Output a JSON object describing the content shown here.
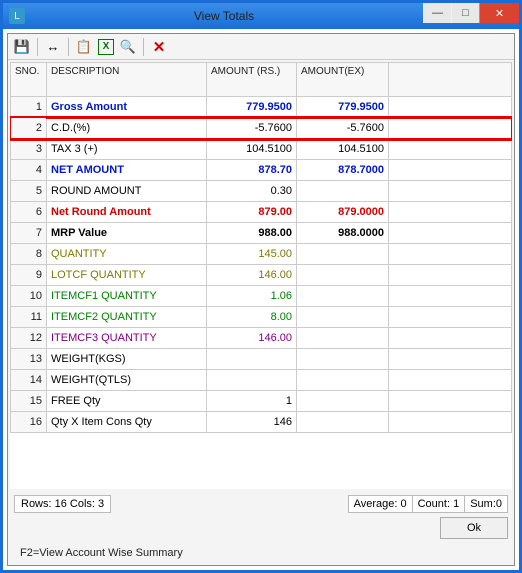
{
  "window": {
    "title": "View Totals",
    "app_icon_label": "L"
  },
  "toolbar_icons": {
    "save": "💾",
    "fit": "↔",
    "copy": "📋",
    "excel": "X",
    "find": "🔍",
    "delete": "✕"
  },
  "columns": {
    "sno": "SNO.",
    "description": "DESCRIPTION",
    "amount_rs": "AMOUNT (RS.)",
    "amount_ex": "AMOUNT(EX)"
  },
  "rows": [
    {
      "sno": "1",
      "desc": "Gross Amount",
      "amt1": "779.9500",
      "amt2": "779.9500",
      "cls": "c-blue bold",
      "highlight": false
    },
    {
      "sno": "2",
      "desc": "C.D.(%)",
      "amt1": "-5.7600",
      "amt2": "-5.7600",
      "cls": "c-black",
      "highlight": true
    },
    {
      "sno": "3",
      "desc": "TAX 3 (+)",
      "amt1": "104.5100",
      "amt2": "104.5100",
      "cls": "c-black",
      "highlight": false
    },
    {
      "sno": "4",
      "desc": "NET AMOUNT",
      "amt1": "878.70",
      "amt2": "878.7000",
      "cls": "c-blue bold",
      "highlight": false
    },
    {
      "sno": "5",
      "desc": "ROUND AMOUNT",
      "amt1": "0.30",
      "amt2": "",
      "cls": "c-black",
      "highlight": false
    },
    {
      "sno": "6",
      "desc": "Net Round Amount",
      "amt1": "879.00",
      "amt2": "879.0000",
      "cls": "c-red bold",
      "highlight": false
    },
    {
      "sno": "7",
      "desc": "MRP Value",
      "amt1": "988.00",
      "amt2": "988.0000",
      "cls": "c-black bold",
      "highlight": false
    },
    {
      "sno": "8",
      "desc": "QUANTITY",
      "amt1": "145.00",
      "amt2": "",
      "cls": "c-olive",
      "highlight": false
    },
    {
      "sno": "9",
      "desc": "LOTCF    QUANTITY",
      "amt1": "146.00",
      "amt2": "",
      "cls": "c-olive",
      "highlight": false
    },
    {
      "sno": "10",
      "desc": "ITEMCF1   QUANTITY",
      "amt1": "1.06",
      "amt2": "",
      "cls": "c-green",
      "highlight": false
    },
    {
      "sno": "11",
      "desc": "ITEMCF2   QUANTITY",
      "amt1": "8.00",
      "amt2": "",
      "cls": "c-green",
      "highlight": false
    },
    {
      "sno": "12",
      "desc": "ITEMCF3   QUANTITY",
      "amt1": "146.00",
      "amt2": "",
      "cls": "c-purple",
      "highlight": false
    },
    {
      "sno": "13",
      "desc": "WEIGHT(KGS)",
      "amt1": "",
      "amt2": "",
      "cls": "c-black",
      "highlight": false
    },
    {
      "sno": "14",
      "desc": "WEIGHT(QTLS)",
      "amt1": "",
      "amt2": "",
      "cls": "c-black",
      "highlight": false
    },
    {
      "sno": "15",
      "desc": "FREE Qty",
      "amt1": "1",
      "amt2": "",
      "cls": "c-black",
      "highlight": false
    },
    {
      "sno": "16",
      "desc": "Qty X Item Cons Qty",
      "amt1": "146",
      "amt2": "",
      "cls": "c-black",
      "highlight": false
    }
  ],
  "status": {
    "left": "Rows: 16  Cols: 3",
    "avg": "Average: 0",
    "count": "Count: 1",
    "sum": "Sum:0"
  },
  "buttons": {
    "ok": "Ok"
  },
  "hint": "F2=View Account Wise Summary"
}
